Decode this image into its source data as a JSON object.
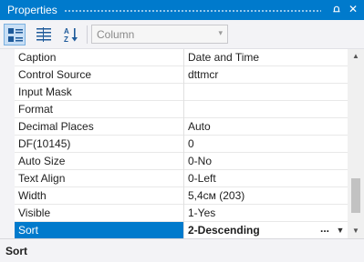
{
  "panel": {
    "title": "Properties",
    "pin_glyph": "⩍",
    "close_glyph": "✕"
  },
  "toolbar": {
    "categorized_icon": "categorized-icon",
    "list_icon": "property-list-icon",
    "sort_icon": "sort-az-icon",
    "categorized_active": true,
    "object_select": {
      "value": "Column",
      "arrow": "▾"
    }
  },
  "properties": [
    {
      "name": "Caption",
      "value": "Date and Time"
    },
    {
      "name": "Control Source",
      "value": "dttmcr"
    },
    {
      "name": "Input Mask",
      "value": ""
    },
    {
      "name": "Format",
      "value": ""
    },
    {
      "name": "Decimal Places",
      "value": "Auto"
    },
    {
      "name": "DF(10145)",
      "value": "0"
    },
    {
      "name": "Auto Size",
      "value": "0-No"
    },
    {
      "name": "Text Align",
      "value": "0-Left"
    },
    {
      "name": "Width",
      "value": "5,4см (203)"
    },
    {
      "name": "Visible",
      "value": "1-Yes"
    },
    {
      "name": "Sort",
      "value": "2-Descending",
      "selected": true,
      "ellipsis": "...",
      "dropdown": "▼"
    }
  ],
  "scrollbar": {
    "up": "▲",
    "down": "▼",
    "position": 0.9
  },
  "description": {
    "title": "Sort"
  },
  "colors": {
    "accent": "#007acc",
    "selected_row": "#007acc",
    "toolbar_bg": "#f3f3f6"
  }
}
